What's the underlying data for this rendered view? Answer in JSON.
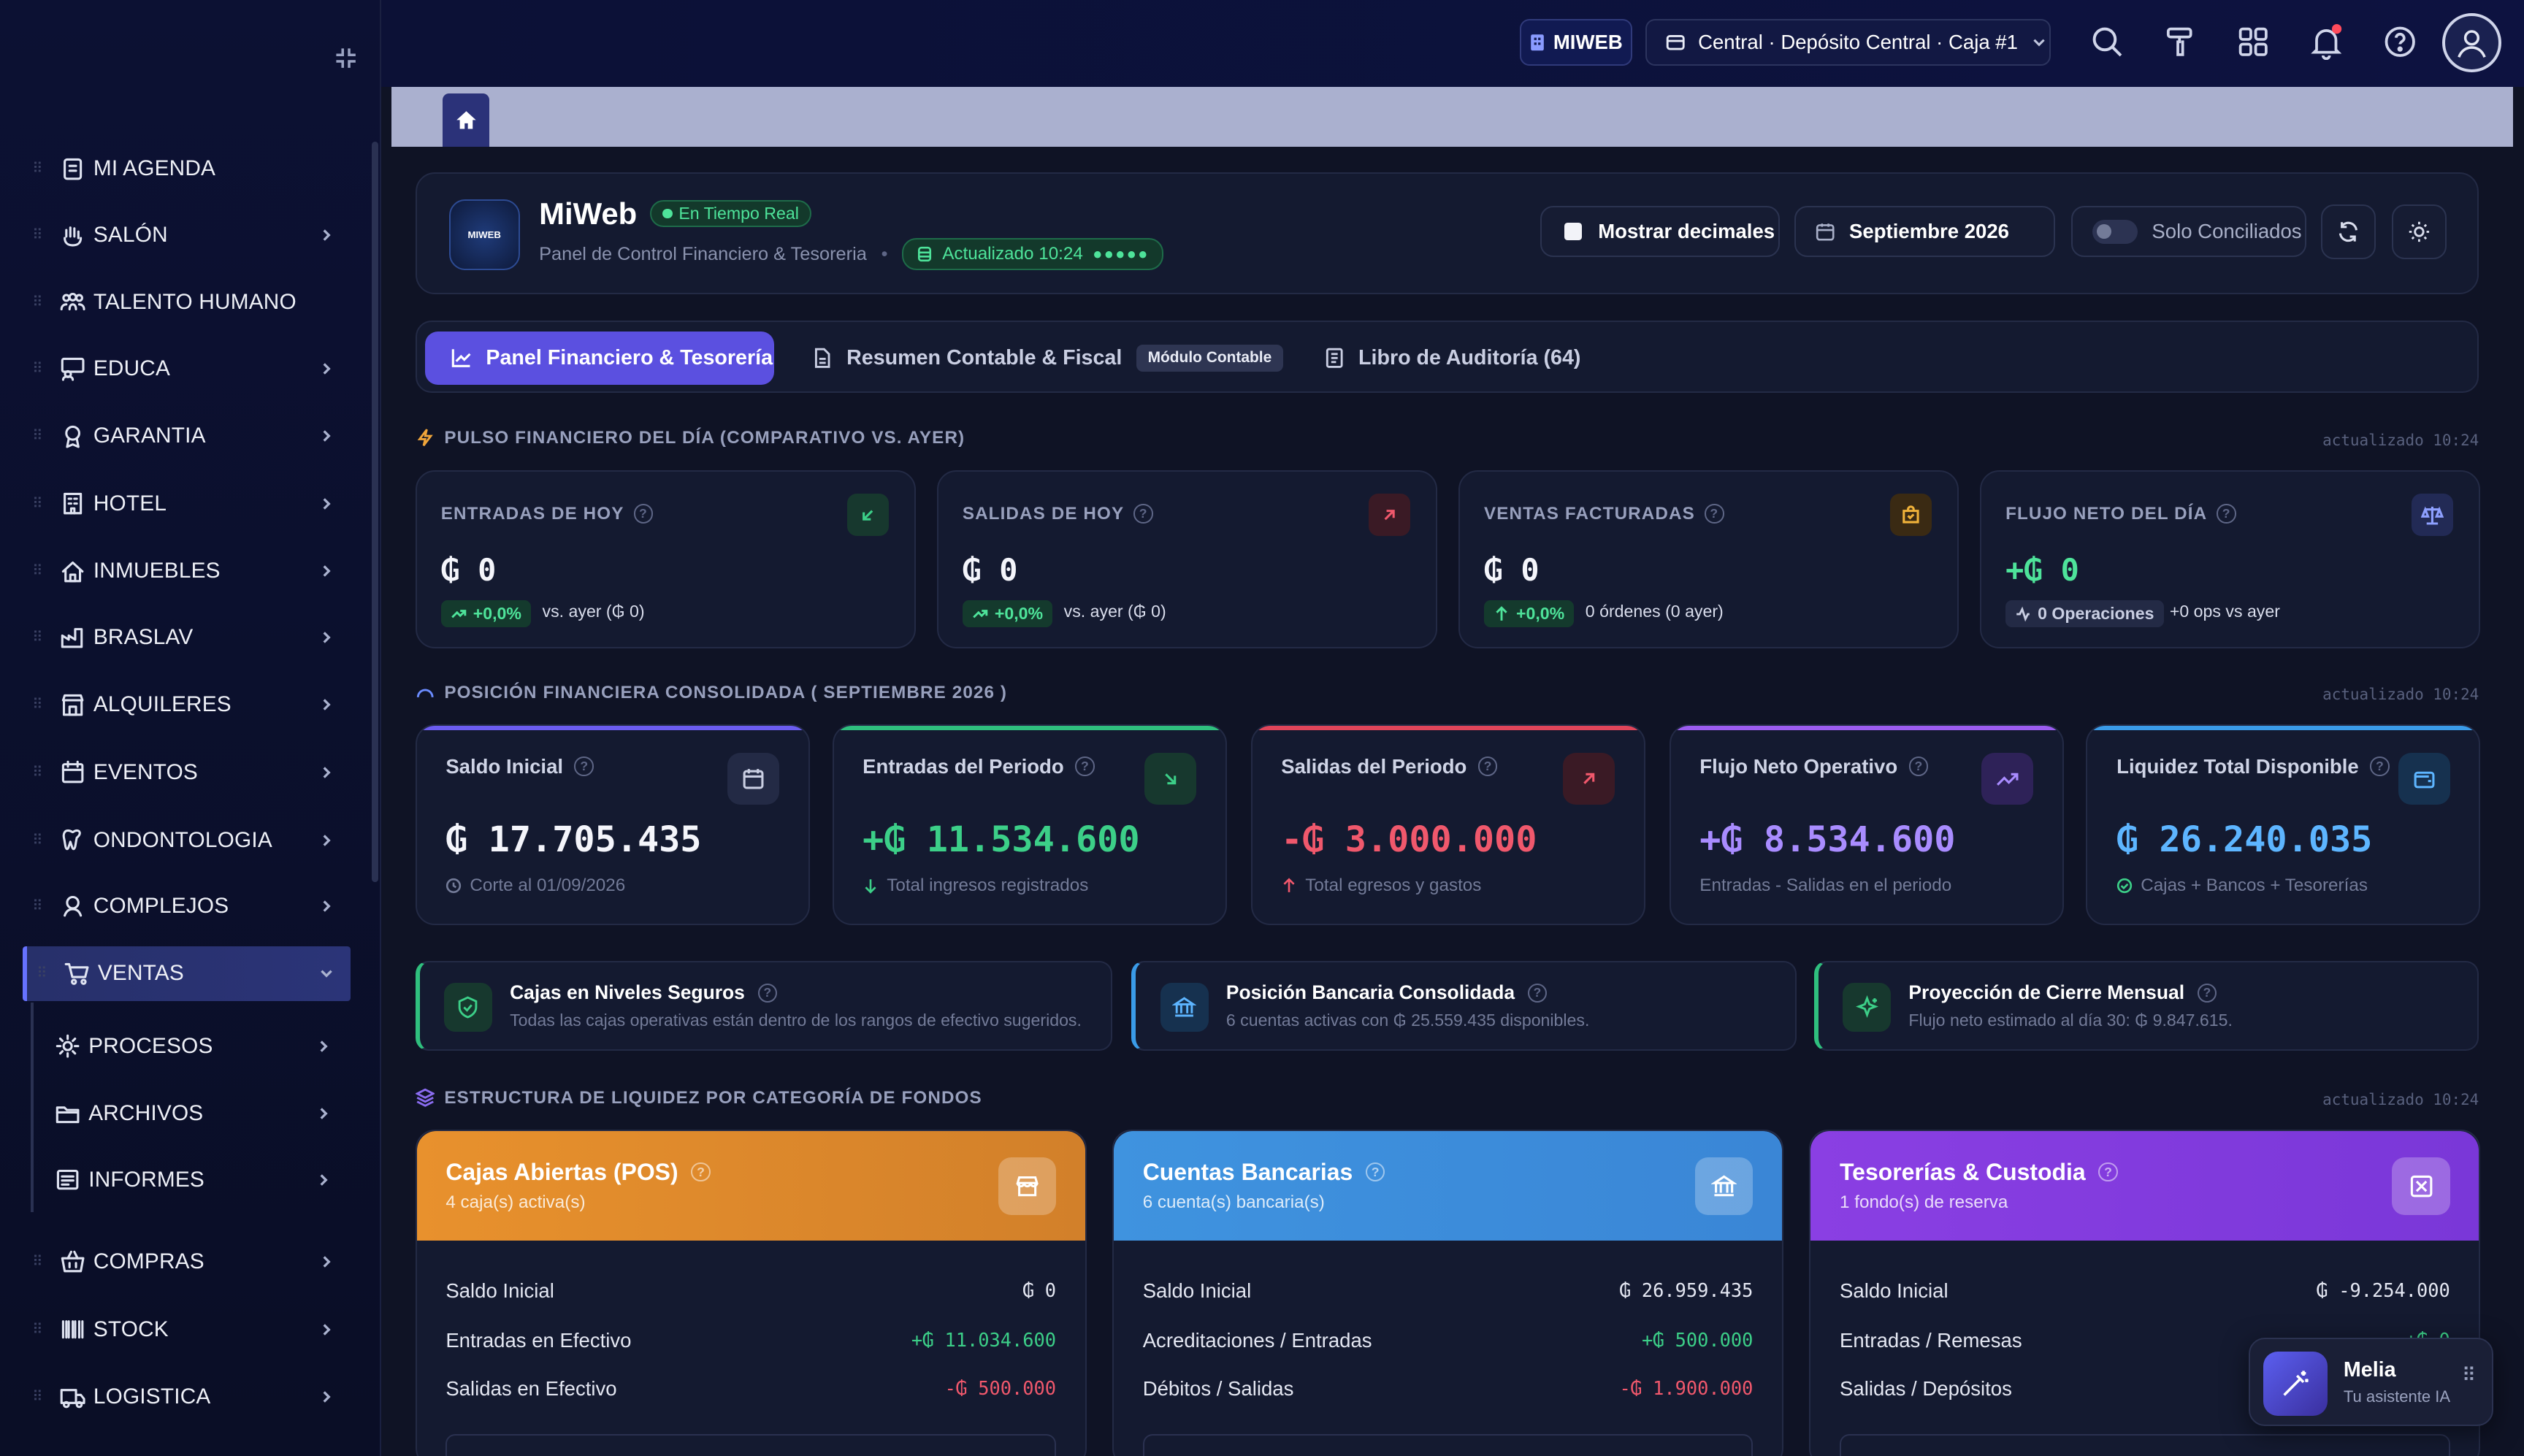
{
  "sidebar": {
    "items": [
      {
        "label": "MI AGENDA",
        "icon": "agenda-icon",
        "chevron": false
      },
      {
        "label": "SALÓN",
        "icon": "hand-icon",
        "chevron": true
      },
      {
        "label": "TALENTO HUMANO",
        "icon": "people-icon",
        "chevron": false
      },
      {
        "label": "EDUCA",
        "icon": "teacher-icon",
        "chevron": true
      },
      {
        "label": "GARANTIA",
        "icon": "badge-icon",
        "chevron": true
      },
      {
        "label": "HOTEL",
        "icon": "hotel-icon",
        "chevron": true
      },
      {
        "label": "INMUEBLES",
        "icon": "house-icon",
        "chevron": true
      },
      {
        "label": "BRASLAV",
        "icon": "factory-icon",
        "chevron": true
      },
      {
        "label": "ALQUILERES",
        "icon": "store-icon",
        "chevron": true
      },
      {
        "label": "EVENTOS",
        "icon": "calendar-icon",
        "chevron": true
      },
      {
        "label": "ONDONTOLOGIA",
        "icon": "tooth-icon",
        "chevron": true
      },
      {
        "label": "COMPLEJOS",
        "icon": "complex-icon",
        "chevron": true
      },
      {
        "label": "VENTAS",
        "icon": "cart-icon",
        "chevron": true
      }
    ],
    "sub_items": [
      {
        "label": "PROCESOS",
        "icon": "gear-icon"
      },
      {
        "label": "ARCHIVOS",
        "icon": "folder-icon"
      },
      {
        "label": "INFORMES",
        "icon": "report-icon"
      }
    ],
    "bottom_items": [
      {
        "label": "COMPRAS",
        "icon": "basket-icon"
      },
      {
        "label": "STOCK",
        "icon": "barcode-icon"
      },
      {
        "label": "LOGISTICA",
        "icon": "truck-icon"
      }
    ]
  },
  "topbar": {
    "company": "MIWEB",
    "location": "Central · Depósito Central · Caja #1"
  },
  "header": {
    "title": "MiWeb",
    "logo_text": "MIWEB",
    "live_badge": "En Tiempo Real",
    "subtitle": "Panel de Control Financiero & Tesoreria",
    "updated": "Actualizado 10:24",
    "show_decimals": "Mostrar decimales",
    "month": "Septiembre 2026",
    "only_reconciled": "Solo Conciliados"
  },
  "tabs": [
    {
      "label": "Panel Financiero & Tesorería"
    },
    {
      "label": "Resumen Contable & Fiscal",
      "badge": "Módulo Contable"
    },
    {
      "label": "Libro de Auditoría (64)"
    }
  ],
  "pulse": {
    "title": "PULSO FINANCIERO DEL DÍA (COMPARATIVO VS. AYER)",
    "updated": "actualizado 10:24",
    "cards": [
      {
        "title": "ENTRADAS DE HOY",
        "value": "₲ 0",
        "chip": "+0,0%",
        "compare": "vs. ayer (₲ 0)"
      },
      {
        "title": "SALIDAS DE HOY",
        "value": "₲ 0",
        "chip": "+0,0%",
        "compare": "vs. ayer (₲ 0)"
      },
      {
        "title": "VENTAS FACTURADAS",
        "value": "₲ 0",
        "chip": "+0,0%",
        "compare": "0 órdenes (0 ayer)"
      },
      {
        "title": "FLUJO NETO DEL DÍA",
        "value": "+₲ 0",
        "chip": "0 Operaciones",
        "compare": "+0 ops vs ayer"
      }
    ]
  },
  "position": {
    "title": "POSICIÓN FINANCIERA CONSOLIDADA ( SEPTIEMBRE 2026 )",
    "updated": "actualizado 10:24",
    "cards": [
      {
        "title": "Saldo Inicial",
        "value": "₲ 17.705.435",
        "sub": "Corte al 01/09/2026",
        "color": "#6b5cf0"
      },
      {
        "title": "Entradas del Periodo",
        "value": "+₲ 11.534.600",
        "sub": "Total ingresos registrados",
        "color": "#2fbf7e"
      },
      {
        "title": "Salidas del Periodo",
        "value": "-₲ 3.000.000",
        "sub": "Total egresos y gastos",
        "color": "#e0455a"
      },
      {
        "title": "Flujo Neto Operativo",
        "value": "+₲ 8.534.600",
        "sub": "Entradas - Salidas en el periodo",
        "color": "#9b5cf0"
      },
      {
        "title": "Liquidez Total Disponible",
        "value": "₲ 26.240.035",
        "sub": "Cajas + Bancos + Tesorerías",
        "color": "#3a9be8"
      }
    ]
  },
  "alerts": [
    {
      "title": "Cajas en Niveles Seguros",
      "text": "Todas las cajas operativas están dentro de los rangos de efectivo sugeridos."
    },
    {
      "title": "Posición Bancaria Consolidada",
      "text": "6 cuentas activas con ₲ 25.559.435 disponibles."
    },
    {
      "title": "Proyección de Cierre Mensual",
      "text": "Flujo neto estimado al día 30: ₲ 9.847.615."
    }
  ],
  "liquidity": {
    "title": "ESTRUCTURA DE LIQUIDEZ POR CATEGORÍA DE FONDOS",
    "updated": "actualizado 10:24",
    "cards": [
      {
        "title": "Cajas Abiertas (POS)",
        "sub": "4 caja(s) activa(s)",
        "rows": [
          {
            "label": "Saldo Inicial",
            "value": "₲ 0"
          },
          {
            "label": "Entradas en Efectivo",
            "value": "+₲ 11.034.600"
          },
          {
            "label": "Salidas en Efectivo",
            "value": "-₲ 500.000"
          }
        ]
      },
      {
        "title": "Cuentas Bancarias",
        "sub": "6 cuenta(s) bancaria(s)",
        "rows": [
          {
            "label": "Saldo Inicial",
            "value": "₲ 26.959.435"
          },
          {
            "label": "Acreditaciones / Entradas",
            "value": "+₲ 500.000"
          },
          {
            "label": "Débitos / Salidas",
            "value": "-₲ 1.900.000"
          }
        ]
      },
      {
        "title": "Tesorerías & Custodia",
        "sub": "1 fondo(s) de reserva",
        "rows": [
          {
            "label": "Saldo Inicial",
            "value": "₲ -9.254.000"
          },
          {
            "label": "Entradas / Remesas",
            "value": "+₲ 0"
          },
          {
            "label": "Salidas / Depósitos",
            "value": ""
          }
        ]
      }
    ]
  },
  "assistant": {
    "name": "Melia",
    "subtitle": "Tu asistente IA"
  }
}
